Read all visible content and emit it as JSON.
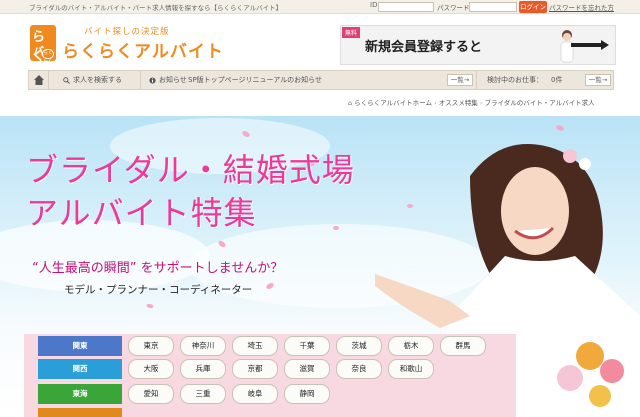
{
  "topbar": {
    "description": "ブライダルのバイト・アルバイト・パート求人情報を探すなら【らくらくアルバイト】",
    "id_label": "ID",
    "password_label": "パスワード",
    "login": "ログイン",
    "forgot": "パスワードを忘れた方"
  },
  "header": {
    "logo_top": "らく",
    "logo_bottom": "バ",
    "logo_badge": "らくらく",
    "tagline": "バイト探しの決定版",
    "brand": "らくらくアルバイト"
  },
  "banner": {
    "badge": "無料",
    "text": "新規会員登録すると"
  },
  "nav": {
    "home_icon": "home-icon",
    "search_label": "求人を検索する",
    "news_label": "お知らせ",
    "news_text": "SP版トップページリニューアルのお知らせ",
    "list_label": "一覧→",
    "considering_label": "検討中のお仕事：",
    "considering_count": "0件",
    "list_label2": "一覧→"
  },
  "breadcrumb": {
    "home": "らくらくアルバイトホーム",
    "feature": "オススメ特集",
    "current": "ブライダルのバイト・アルバイト求人"
  },
  "hero": {
    "title_line1": "ブライダル・結婚式場",
    "title_line2": "アルバイト特集",
    "subtitle": "“人生最高の瞬間” をサポートしませんか？",
    "roles": "モデル・プランナー・コーディネーター"
  },
  "areas": [
    {
      "name": "関東",
      "color": "#4d77c8",
      "prefs": [
        "東京",
        "神奈川",
        "埼玉",
        "千葉",
        "茨城",
        "栃木",
        "群馬"
      ]
    },
    {
      "name": "関西",
      "color": "#2a9ed8",
      "prefs": [
        "大阪",
        "兵庫",
        "京都",
        "滋賀",
        "奈良",
        "和歌山"
      ]
    },
    {
      "name": "東海",
      "color": "#3aa63a",
      "prefs": [
        "愛知",
        "三重",
        "岐阜",
        "静岡"
      ]
    },
    {
      "name": "",
      "color": "#e08a1e",
      "prefs": []
    }
  ],
  "colors": {
    "brand_orange": "#f08a1e",
    "title_pink": "#f0379a",
    "login_orange": "#e85a2a"
  }
}
